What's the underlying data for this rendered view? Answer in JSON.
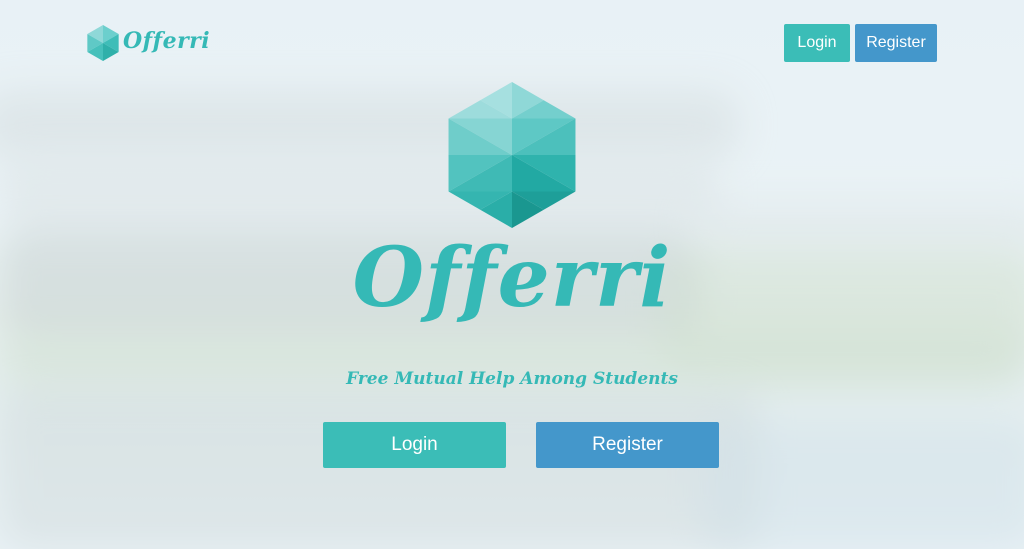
{
  "header": {
    "brand": "Offerri",
    "logo_icon": "hexagon-gem-icon",
    "login_label": "Login",
    "register_label": "Register"
  },
  "hero": {
    "title": "Offerri",
    "tagline": "Free Mutual Help Among Students",
    "logo_icon": "hexagon-gem-icon",
    "login_label": "Login",
    "register_label": "Register"
  },
  "colors": {
    "teal": "#3bbdb7",
    "blue": "#4497cb",
    "brand_text": "#35b9b6"
  }
}
